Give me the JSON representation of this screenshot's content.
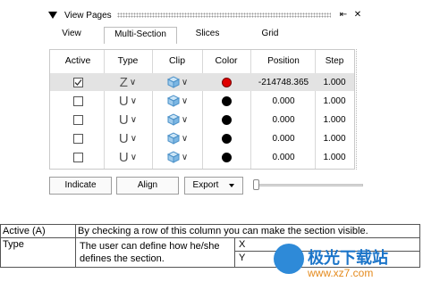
{
  "panel": {
    "title": "View Pages",
    "pin_glyph": "⇤",
    "close_glyph": "✕"
  },
  "tabs": [
    {
      "label": "View",
      "active": false
    },
    {
      "label": "Multi-Section",
      "active": true
    },
    {
      "label": "Slices",
      "active": false
    },
    {
      "label": "Grid",
      "active": false
    }
  ],
  "grid": {
    "columns": [
      "Active",
      "Type",
      "Clip",
      "Color",
      "Position",
      "Step"
    ],
    "rows": [
      {
        "active": true,
        "type": "Z",
        "clip_icon": "cube-icon",
        "color": "#e00000",
        "position": "-214748.365",
        "step": "1.000",
        "selected": true
      },
      {
        "active": false,
        "type": "U",
        "clip_icon": "cube-icon",
        "color": "#000000",
        "position": "0.000",
        "step": "1.000",
        "selected": false
      },
      {
        "active": false,
        "type": "U",
        "clip_icon": "cube-icon",
        "color": "#000000",
        "position": "0.000",
        "step": "1.000",
        "selected": false
      },
      {
        "active": false,
        "type": "U",
        "clip_icon": "cube-icon",
        "color": "#000000",
        "position": "0.000",
        "step": "1.000",
        "selected": false
      },
      {
        "active": false,
        "type": "U",
        "clip_icon": "cube-icon",
        "color": "#000000",
        "position": "0.000",
        "step": "1.000",
        "selected": false
      }
    ]
  },
  "buttons": {
    "indicate": "Indicate",
    "align": "Align",
    "export": "Export"
  },
  "doc_table": {
    "rows": [
      {
        "key": "Active (A)",
        "text": "By checking a row of this column you can make the section visible."
      },
      {
        "key": "Type",
        "text": "The user can define how he/she defines the section.",
        "options": [
          "X",
          "Y"
        ]
      }
    ]
  },
  "watermark": {
    "brand": "极光下载站",
    "url": "www.xz7.com"
  }
}
